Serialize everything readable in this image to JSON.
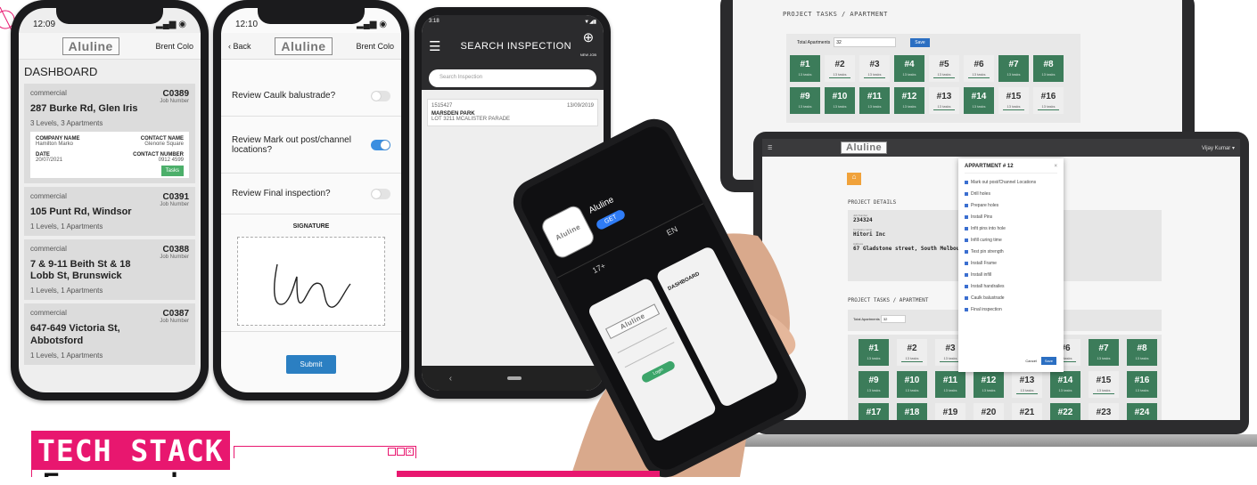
{
  "phone1": {
    "time": "12:09",
    "logo": "Aluline",
    "user": "Brent Colo",
    "title": "DASHBOARD",
    "jobs": [
      {
        "type": "commercial",
        "code": "C0389",
        "code_label": "Job Number",
        "addr": "287 Burke Rd, Glen Iris",
        "meta": "3 Levels, 3 Apartments",
        "company_label": "COMPANY NAME",
        "company": "Hamilton Marko",
        "contact_label": "CONTACT NAME",
        "contact": "Glenorie Square",
        "date_label": "DATE",
        "date": "20/07/2021",
        "phone_label": "CONTACT NUMBER",
        "phone": "0912 4599",
        "tasks": "Tasks"
      },
      {
        "type": "commercial",
        "code": "C0391",
        "code_label": "Job Number",
        "addr": "105 Punt Rd, Windsor",
        "meta": "1 Levels, 1 Apartments"
      },
      {
        "type": "commercial",
        "code": "C0388",
        "code_label": "Job Number",
        "addr": "7 & 9-11 Beith St & 18 Lobb St, Brunswick",
        "meta": "1 Levels, 1 Apartments"
      },
      {
        "type": "commercial",
        "code": "C0387",
        "code_label": "Job Number",
        "addr": "647-649 Victoria St, Abbotsford",
        "meta": "1 Levels, 1 Apartments"
      }
    ]
  },
  "phone2": {
    "time": "12:10",
    "back": "Back",
    "logo": "Aluline",
    "user": "Brent Colo",
    "questions": [
      {
        "text": "Review Caulk balustrade?",
        "on": false
      },
      {
        "text": "Review Mark out post/channel locations?",
        "on": true
      },
      {
        "text": "Review Final inspection?",
        "on": false
      }
    ],
    "signature_label": "SIGNATURE",
    "submit": "Submit"
  },
  "phone3": {
    "time": "3:18",
    "title": "SEARCH INSPECTION",
    "new_job": "NEW JOB",
    "search_placeholder": "Search Inspection",
    "result": {
      "id": "1515427",
      "date": "13/09/2019",
      "name": "MARSDEN PARK",
      "addr": "LOT 3211 MCALISTER PARADE"
    }
  },
  "store_phone": {
    "app_name": "Aluline",
    "get": "GET",
    "age": "17+",
    "lang": "EN",
    "login_logo": "Aluline",
    "login_button": "Login",
    "dash_title": "DASHBOARD"
  },
  "tablet": {
    "section": "PROJECT TASKS / APARTMENT",
    "total_label": "Total Apartments",
    "total_value": "32",
    "save": "Save",
    "tiles": [
      {
        "n": "#1",
        "g": true
      },
      {
        "n": "#2",
        "g": false
      },
      {
        "n": "#3",
        "g": false
      },
      {
        "n": "#4",
        "g": true
      },
      {
        "n": "#5",
        "g": false
      },
      {
        "n": "#6",
        "g": false
      },
      {
        "n": "#7",
        "g": true
      },
      {
        "n": "#8",
        "g": true
      },
      {
        "n": "#9",
        "g": true
      },
      {
        "n": "#10",
        "g": true
      },
      {
        "n": "#11",
        "g": true
      },
      {
        "n": "#12",
        "g": true
      },
      {
        "n": "#13",
        "g": false
      },
      {
        "n": "#14",
        "g": true
      },
      {
        "n": "#15",
        "g": false
      },
      {
        "n": "#16",
        "g": false
      }
    ],
    "tile_sub": "13 tasks"
  },
  "laptop": {
    "logo": "Aluline",
    "user": "Vijay Kumar",
    "details_title": "PROJECT DETAILS",
    "job_number_label": "Job Number",
    "job_number": "234324",
    "company_label": "Company name",
    "company": "Hitori Inc",
    "address_label": "Address",
    "address": "67 Gladstone street, South Melbourne",
    "tasks_title": "PROJECT TASKS / APARTMENT",
    "total_label": "Total Apartments",
    "total_value": "32",
    "modal_title": "APPARTMENT # 12",
    "modal_items": [
      "Mark out post/Channel Locations",
      "Drill holes",
      "Prepare holes",
      "Install Pins",
      "Infit pins into hole",
      "Infill curing time",
      "Test pin strength",
      "Install Frame",
      "Install infill",
      "Install handrailes",
      "Caulk balustrade",
      "Final inspection"
    ],
    "cancel": "Cancel",
    "save": "Save",
    "tile_sub": "13 tasks",
    "tiles": [
      {
        "n": "#1",
        "g": true
      },
      {
        "n": "#2",
        "g": false
      },
      {
        "n": "#3",
        "g": false
      },
      {
        "n": "#6",
        "g": false
      },
      {
        "n": "#7",
        "g": true
      },
      {
        "n": "#8",
        "g": true
      },
      {
        "n": "#9",
        "g": true
      },
      {
        "n": "#10",
        "g": true
      },
      {
        "n": "#11",
        "g": true
      },
      {
        "n": "#12",
        "g": true
      },
      {
        "n": "#13",
        "g": false
      },
      {
        "n": "#14",
        "g": true
      },
      {
        "n": "#15",
        "g": false
      },
      {
        "n": "#16",
        "g": true
      },
      {
        "n": "#17",
        "g": true
      },
      {
        "n": "#18",
        "g": true
      },
      {
        "n": "#19",
        "g": false
      },
      {
        "n": "#20",
        "g": false
      },
      {
        "n": "#21",
        "g": false
      },
      {
        "n": "#22",
        "g": true
      },
      {
        "n": "#23",
        "g": false
      },
      {
        "n": "#24",
        "g": true
      }
    ]
  },
  "banner": {
    "title": "TECH STACK",
    "subtitle": "Frameworks"
  },
  "colors": {
    "accent": "#e8176f",
    "green": "#3c7c5a",
    "blue": "#3b8ee0"
  }
}
